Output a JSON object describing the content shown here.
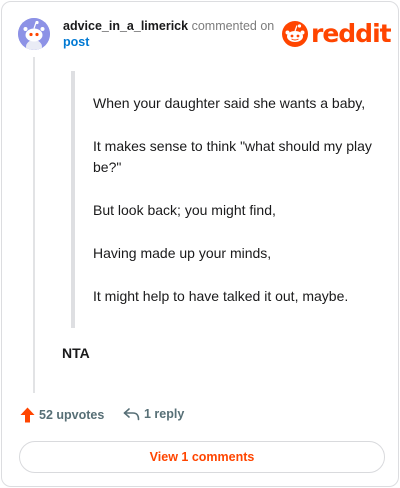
{
  "comment": {
    "username": "advice_in_a_limerick",
    "action_text": "commented on",
    "target_link": "post",
    "body_lines": [
      "When your daughter said she wants a baby,",
      "It makes sense to think \"what should my play be?\"",
      "But look back; you might find,",
      "Having made up your minds,",
      "It might help to have talked it out, maybe."
    ],
    "verdict": "NTA"
  },
  "brand": {
    "wordmark": "reddit",
    "color": "#ff4500"
  },
  "actions": {
    "upvotes_label": "52 upvotes",
    "reply_label": "1 reply",
    "view_comments_label": "View 1 comments"
  },
  "icons": {
    "avatar": "snoo-avatar-icon",
    "logo": "reddit-logo-icon",
    "upvote": "upvote-arrow-icon",
    "reply": "reply-arrow-icon"
  }
}
